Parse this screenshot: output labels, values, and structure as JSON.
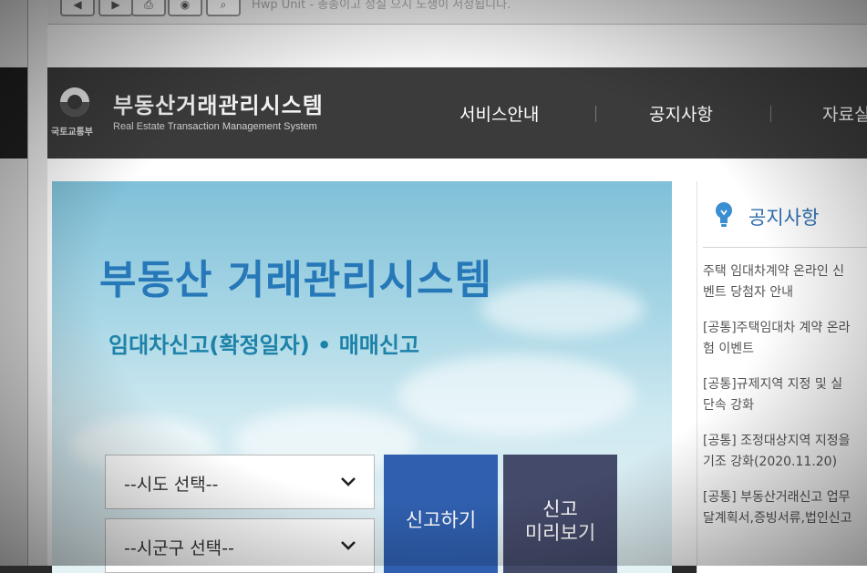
{
  "toolbar": {
    "buttons": [
      "back-icon",
      "forward-icon",
      "print-icon",
      "mouse-icon",
      "search-icon"
    ],
    "hint_text": "Hwp Unit - 총송이고 성실 으시 노생이 서정됩니다."
  },
  "header": {
    "ministry": "국토교통부",
    "title": "부동산거래관리시스템",
    "subtitle": "Real Estate Transaction Management System",
    "nav": [
      "서비스안내",
      "공지사항",
      "자료실"
    ]
  },
  "hero": {
    "title": "부동산 거래관리시스템",
    "subtitle": "임대차신고(확정일자) • 매매신고",
    "sido_select": "--시도 선택--",
    "sigungu_select": "--시군구 선택--",
    "report_button": "신고하기",
    "preview_button_line1": "신고",
    "preview_button_line2": "미리보기"
  },
  "notice": {
    "title": "공지사항",
    "items": [
      {
        "line1": "주택 임대차계약 온라인 신",
        "line2": "벤트 당첨자 안내"
      },
      {
        "line1": "[공통]주택임대차 계약 온라",
        "line2": "험 이벤트"
      },
      {
        "line1": "[공통]규제지역 지정 및 실",
        "line2": "단속 강화"
      },
      {
        "line1": "[공통] 조정대상지역 지정을",
        "line2": "기조 강화(2020.11.20)"
      },
      {
        "line1": "[공통] 부동산거래신고 업무",
        "line2": "달계획서,증빙서류,법인신고"
      }
    ]
  },
  "colors": {
    "header_bg": "#3b3b3b",
    "hero_title": "#2778b8",
    "report_button": "#2f5fae",
    "preview_button": "#444a6a",
    "notice_title": "#2f6fb0"
  }
}
